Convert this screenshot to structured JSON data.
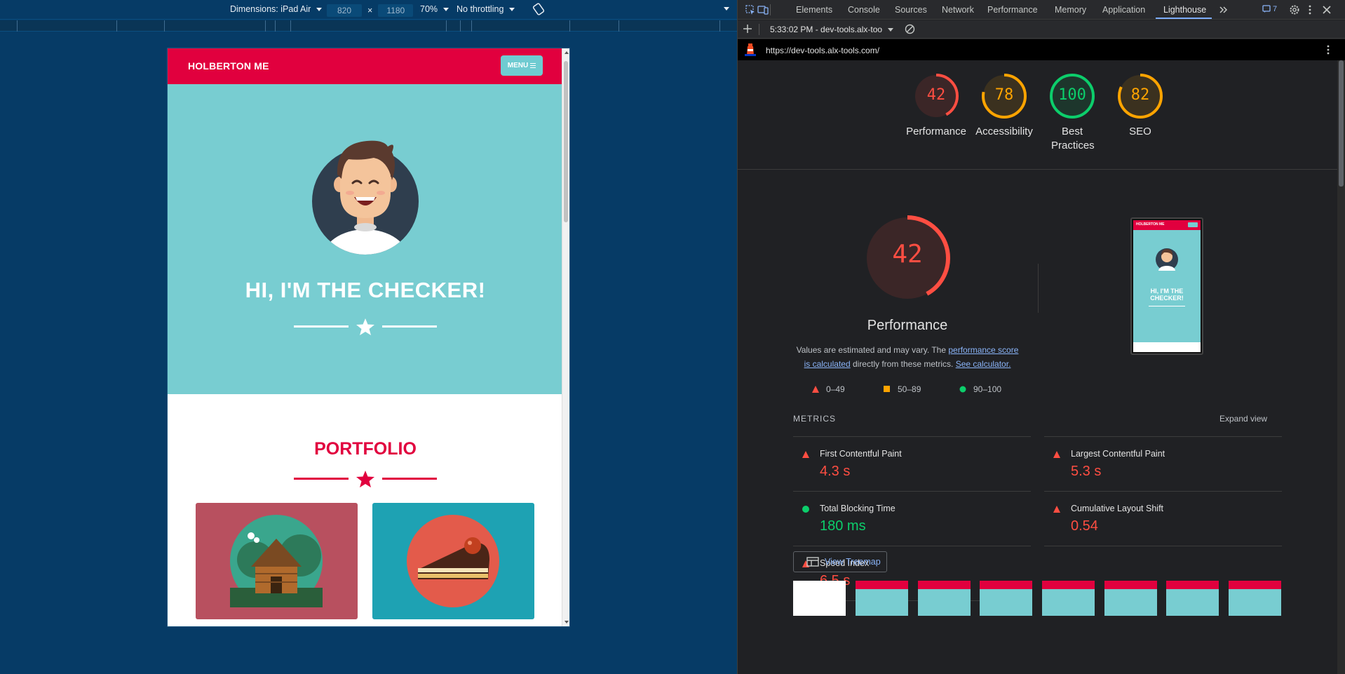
{
  "device_toolbar": {
    "dimensions_label": "Dimensions: iPad Air",
    "width_value": "820",
    "times": "×",
    "height_value": "1180",
    "zoom": "70%",
    "throttling": "No throttling"
  },
  "site": {
    "brand": "HOLBERTON ME",
    "menu_label": "MENU",
    "hero_title": "HI, I'M THE CHECKER!",
    "portfolio_title": "PORTFOLIO",
    "colors": {
      "header": "#e1003e",
      "hero": "#78cdd1",
      "card_cabin": "#b8505f",
      "card_cake": "#1ea2b3"
    }
  },
  "devtools": {
    "tabs": [
      "Elements",
      "Console",
      "Sources",
      "Network",
      "Performance",
      "Memory",
      "Application",
      "Lighthouse"
    ],
    "active_tab": "Lighthouse",
    "issues_count": "7",
    "report_selector": "5:33:02 PM - dev-tools.alx-too",
    "url": "https://dev-tools.alx-tools.com/"
  },
  "lighthouse": {
    "gauges": [
      {
        "score": 42,
        "label": "Performance",
        "color": "#ff4e42"
      },
      {
        "score": 78,
        "label": "Accessibility",
        "color": "#ffa400"
      },
      {
        "score": 100,
        "label": "Best Practices",
        "color": "#0cce6b"
      },
      {
        "score": 82,
        "label": "SEO",
        "color": "#ffa400"
      }
    ],
    "perf": {
      "score": "42",
      "title": "Performance",
      "desc_pre": "Values are estimated and may vary. The ",
      "desc_link": "performance score is calculated",
      "desc_mid": " directly from these metrics. ",
      "desc_calc": "See calculator."
    },
    "legend": [
      "0–49",
      "50–89",
      "90–100"
    ],
    "metrics_heading": "METRICS",
    "expand_view": "Expand view",
    "metrics": [
      {
        "name": "First Contentful Paint",
        "value": "4.3 s",
        "status": "fail"
      },
      {
        "name": "Largest Contentful Paint",
        "value": "5.3 s",
        "status": "fail"
      },
      {
        "name": "Total Blocking Time",
        "value": "180 ms",
        "status": "pass"
      },
      {
        "name": "Cumulative Layout Shift",
        "value": "0.54",
        "status": "fail"
      },
      {
        "name": "Speed Index",
        "value": "6.5 s",
        "status": "fail"
      }
    ],
    "view_treemap": "View Treemap",
    "thumb_brand": "HOLBERTON ME",
    "thumb_title": "HI, I'M THE CHECKER!"
  }
}
